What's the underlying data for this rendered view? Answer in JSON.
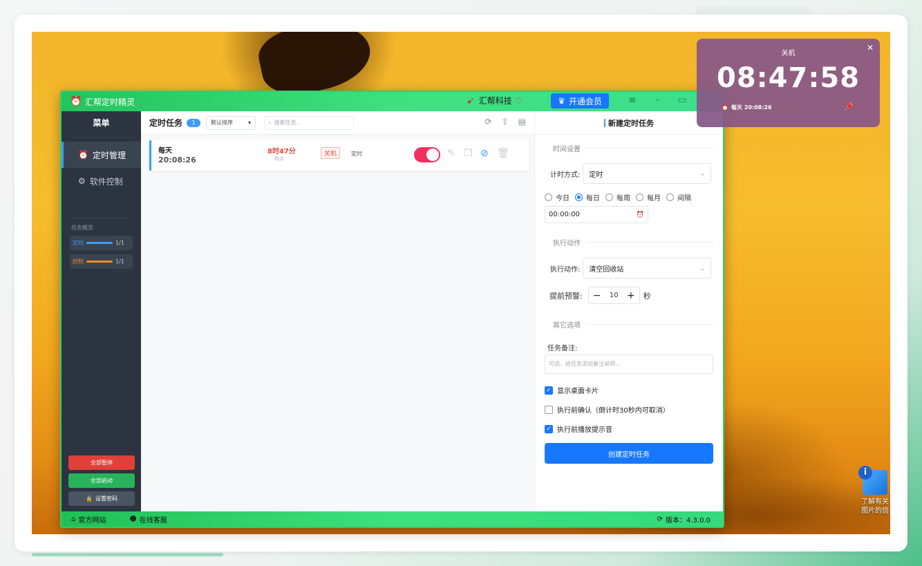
{
  "app": {
    "title": "汇帮定时精灵",
    "brand": "汇帮科技",
    "vip_label": "开通会员"
  },
  "sidebar": {
    "title": "菜单",
    "items": [
      {
        "label": "定时管理"
      },
      {
        "label": "软件控制"
      }
    ],
    "overview_label": "任务概览",
    "stats": [
      {
        "label": "定时",
        "value": "1/1",
        "color": "#3b9cff"
      },
      {
        "label": "控制",
        "value": "1/1",
        "color": "#f08a24"
      }
    ],
    "buttons": {
      "pause_all": "全部暂停",
      "start_all": "全部启动",
      "set_password": "设置密码"
    }
  },
  "task_list": {
    "title": "定时任务",
    "count": "1",
    "sort_label": "默认排序",
    "search_placeholder": "搜索任务...",
    "tasks": [
      {
        "name": "每天",
        "time": "20:08:26",
        "remaining": "8时47分",
        "remaining_label": "剩余",
        "action": "关机",
        "type": "定时",
        "enabled": true
      }
    ]
  },
  "form": {
    "title": "新建定时任务",
    "section_time": "时间设置",
    "timing_mode_label": "计时方式:",
    "timing_mode_value": "定时",
    "repeat_options": [
      "今日",
      "每日",
      "每周",
      "每月",
      "间隔"
    ],
    "repeat_selected": "每日",
    "time_value": "00:00:00",
    "section_action": "执行动作",
    "action_label": "执行动作:",
    "action_value": "清空回收站",
    "warn_label": "提前预警:",
    "warn_value": "10",
    "warn_unit": "秒",
    "section_other": "其它选项",
    "note_label": "任务备注:",
    "note_placeholder": "可选，给任务添加备注说明...",
    "checks": [
      {
        "label": "显示桌面卡片",
        "checked": true
      },
      {
        "label": "执行前确认（倒计时30秒内可取消）",
        "checked": false
      },
      {
        "label": "执行前播放提示音",
        "checked": true
      }
    ],
    "submit_label": "创建定时任务"
  },
  "footer": {
    "website": "官方网站",
    "support": "在线客服",
    "version": "版本：4.3.0.0"
  },
  "float_card": {
    "title": "关机",
    "time": "08:47:58",
    "schedule": "每天 20:08:26"
  },
  "desktop": {
    "icon_label": "了解有关图片的信"
  }
}
